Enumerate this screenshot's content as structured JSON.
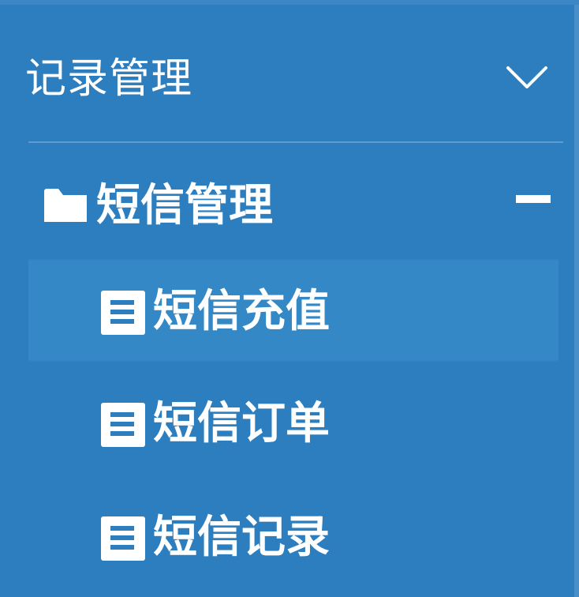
{
  "section": {
    "title": "记录管理",
    "expanded": true
  },
  "group": {
    "label": "短信管理",
    "expanded": true
  },
  "items": [
    {
      "label": "短信充值",
      "active": true
    },
    {
      "label": "短信订单",
      "active": false
    },
    {
      "label": "短信记录",
      "active": false
    }
  ],
  "icons": {
    "section_toggle": "chevron-down-icon",
    "group_icon": "folder-icon",
    "group_toggle": "minus-icon",
    "item_icon": "document-icon"
  },
  "colors": {
    "background": "#2c7ebe",
    "active_item": "#3488c6",
    "text": "#ffffff"
  }
}
